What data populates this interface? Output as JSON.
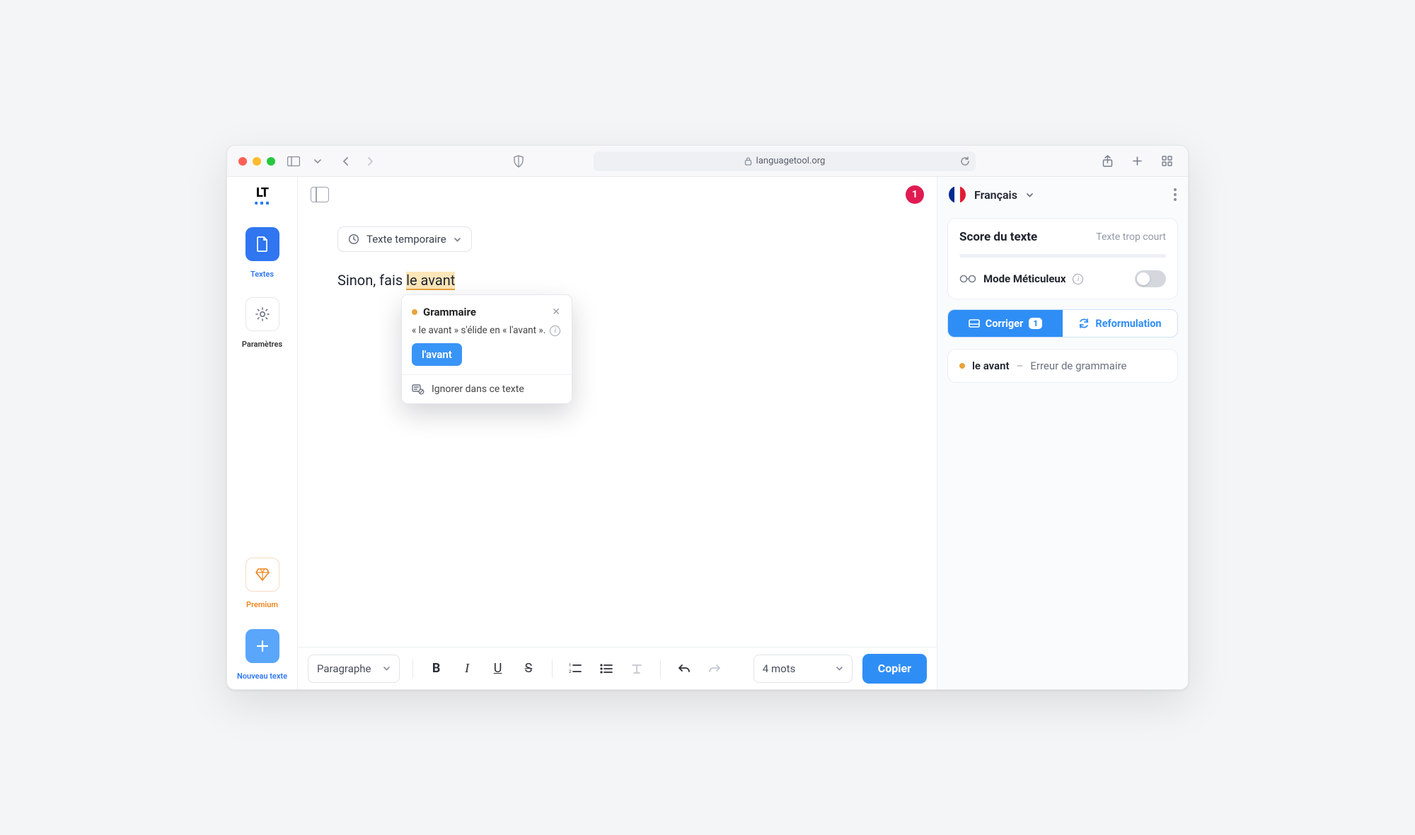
{
  "browser": {
    "url": "languagetool.org"
  },
  "rail": {
    "logo": "LT",
    "texts_label": "Textes",
    "settings_label": "Paramètres",
    "premium_label": "Premium",
    "new_text_label": "Nouveau texte"
  },
  "editor": {
    "error_count": "1",
    "doc_title": "Texte temporaire",
    "text_before": "Sinon, fais ",
    "text_highlight": "le avant"
  },
  "popover": {
    "category": "Grammaire",
    "explanation": "« le avant » s'élide en « l'avant ».",
    "suggestion": "l'avant",
    "ignore": "Ignorer dans ce texte"
  },
  "footer": {
    "style": "Paragraphe",
    "wordcount": "4 mots",
    "copy": "Copier"
  },
  "side": {
    "language": "Français",
    "score_title": "Score du texte",
    "score_sub": "Texte trop court",
    "mode_label": "Mode Méticuleux",
    "tab_correct": "Corriger",
    "tab_correct_count": "1",
    "tab_reformulate": "Reformulation",
    "issue_term": "le avant",
    "issue_msg": "Erreur de grammaire"
  }
}
